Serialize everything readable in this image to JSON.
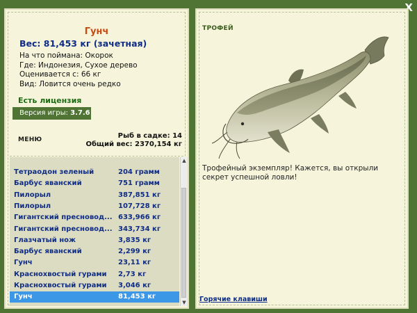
{
  "close_label": "X",
  "fish": {
    "name": "Гунч",
    "weight": "Вес: 81,453 кг (зачетная)",
    "bait": "На что поймана: Окорок",
    "location": "Где: Индонезия, Сухое дерево",
    "value": "Оценивается с: 66 кг",
    "rarity": "Вид: Ловится очень редко"
  },
  "license": "Есть лицензия",
  "version": {
    "label": "Версия игры: ",
    "number": "3.7.6"
  },
  "menu_label": "МЕНЮ",
  "stats": {
    "fish_count": "Рыб в садке: 14",
    "total_weight": "Общий вес: 2370,154 кг"
  },
  "catch_list": [
    {
      "name": "Тетраодон зеленый",
      "weight": "204 грамм"
    },
    {
      "name": "Барбус яванский",
      "weight": "751 грамм"
    },
    {
      "name": "Пилорыл",
      "weight": "387,851 кг"
    },
    {
      "name": "Пилорыл",
      "weight": "107,728 кг"
    },
    {
      "name": "Гигантский пресновод...",
      "weight": "633,966 кг"
    },
    {
      "name": "Гигантский пресновод...",
      "weight": "343,734 кг"
    },
    {
      "name": "Глазчатый нож",
      "weight": "3,835 кг"
    },
    {
      "name": "Барбус яванский",
      "weight": "2,299 кг"
    },
    {
      "name": "Гунч",
      "weight": "23,11 кг"
    },
    {
      "name": "Краснохвостый гурами",
      "weight": "2,73 кг"
    },
    {
      "name": "Краснохвостый гурами",
      "weight": "3,046 кг"
    },
    {
      "name": "Гунч",
      "weight": "81,453 кг",
      "selected": true
    }
  ],
  "trophy_label": "ТРОФЕЙ",
  "trophy_message": "Трофейный экземпляр! Кажется, вы открыли секрет успешной ловли!",
  "hotkeys_label": "Горячие клавиши",
  "colors": {
    "background": "#4f7434",
    "panel": "#f6f5dc",
    "fish_name": "#c84b12",
    "link_blue": "#0f2d86",
    "selection": "#3c98e6"
  },
  "icons": [
    "close-icon",
    "scroll-up-icon",
    "scroll-down-icon",
    "catfish-image"
  ]
}
